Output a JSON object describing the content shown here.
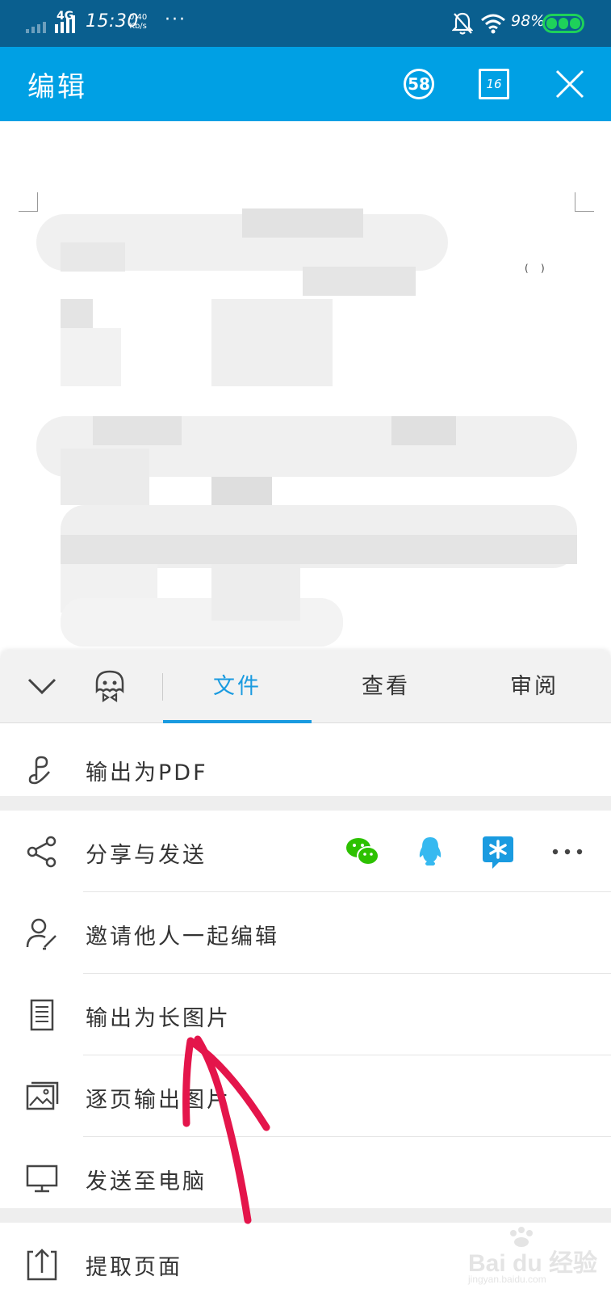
{
  "status_bar": {
    "network": "4G",
    "time": "15:30",
    "speed_value": "0.40",
    "speed_unit": "Kb/s",
    "more": "···",
    "battery": "98%",
    "icons": [
      "signal-icon",
      "bell-off-icon",
      "wifi-icon",
      "battery-icon"
    ]
  },
  "header": {
    "title": "编辑",
    "circle_badge": "58",
    "page_badge": "16",
    "icons": [
      "circle-count-icon",
      "page-count-icon",
      "close-icon"
    ]
  },
  "tabs": {
    "items": [
      {
        "label": "文件",
        "active": true
      },
      {
        "label": "查看",
        "active": false
      },
      {
        "label": "审阅",
        "active": false
      }
    ],
    "accent_color": "#1a9be0"
  },
  "menu": {
    "export_pdf": "输出为PDF",
    "share_send": "分享与发送",
    "invite_edit": "邀请他人一起编辑",
    "export_long_image": "输出为长图片",
    "export_per_page": "逐页输出图片",
    "send_to_pc": "发送至电脑",
    "extract_page": "提取页面",
    "share_targets": [
      "wechat-icon",
      "qq-icon",
      "dingtalk-icon",
      "more-icon"
    ]
  },
  "watermark": {
    "brand": "Bai du 经验",
    "site": "jingyan.baidu.com"
  },
  "colors": {
    "status_bar": "#0a5f8f",
    "title_bar": "#00a0e4",
    "annotation_arrow": "#e4154b"
  }
}
